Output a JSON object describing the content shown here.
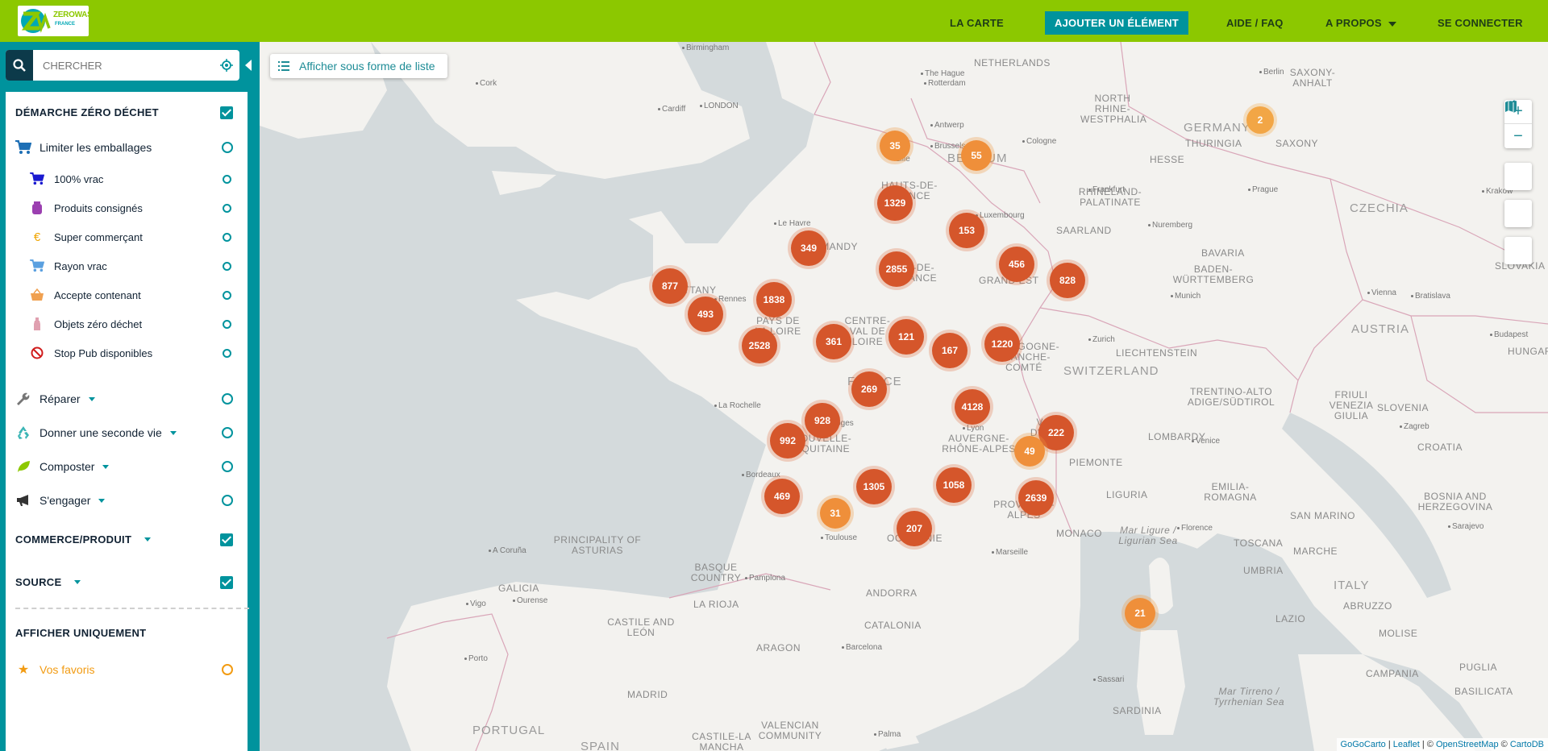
{
  "brand": {
    "logo_text": "ZEROWASTE",
    "logo_sub": "FRANCE"
  },
  "nav": {
    "la_carte": "LA CARTE",
    "ajouter": "AJOUTER UN ÉLÉMENT",
    "aide": "AIDE / FAQ",
    "apropos": "A PROPOS",
    "connecter": "SE CONNECTER"
  },
  "search": {
    "placeholder": "CHERCHER"
  },
  "list_button": "Afficher sous forme de liste",
  "filters": {
    "demarche": "DÉMARCHE ZÉRO DÉCHET",
    "limiter": "Limiter les emballages",
    "sub": [
      "100% vrac",
      "Produits consignés",
      "Super commerçant",
      "Rayon vrac",
      "Accepte contenant",
      "Objets zéro déchet",
      "Stop Pub disponibles"
    ],
    "reparer": "Réparer",
    "donner": "Donner une seconde vie",
    "composter": "Composter",
    "engager": "S'engager",
    "commerce": "COMMERCE/PRODUIT",
    "source": "SOURCE",
    "afficher": "AFFICHER UNIQUEMENT",
    "favoris": "Vos favoris"
  },
  "colors": {
    "brand_green": "#8cc800",
    "teal": "#00939d",
    "cluster": "#d5562b",
    "favoris": "#f29b12"
  },
  "map_labels": {
    "countries": [
      "GERMANY",
      "FRANCE",
      "BELGIUM",
      "CZECHIA",
      "AUSTRIA",
      "SWITZERLAND",
      "ITALY",
      "SPAIN",
      "PORTUGAL",
      "SLOVENIA",
      "CROATIA",
      "LIECHTENSTEIN",
      "SAN MARINO",
      "ANDORRA",
      "MONACO"
    ],
    "regions": [
      "NETHERLANDS",
      "NORTH RHINE-WESTPHALIA",
      "HESSE",
      "THURINGIA",
      "SAXONY",
      "SAXONY-ANHALT",
      "RHINELAND-PALATINATE",
      "SAARLAND",
      "BADEN-WÜRTTEMBERG",
      "BAVARIA",
      "SLOVAKIA",
      "HUNGARY",
      "GRAND EST",
      "BOURGOGNE-FRANCHE-COMTÉ",
      "AUVERGNE-RHÔNE-ALPES",
      "NOUVELLE-AQUITAINE",
      "CENTRE-VAL DE LOIRE",
      "PAYS DE LA LOIRE",
      "BRITTANY",
      "NORMANDY",
      "HAUTS-DE-FRANCE",
      "ÎLE-DE-FRANCE",
      "OCCITANIE",
      "PROVENCE-ALPES",
      "VALLE D'AOSTA",
      "LOMBARDY",
      "PIEMONTE",
      "LIGURIA",
      "EMILIA-ROMAGNA",
      "TOSCANA",
      "UMBRIA",
      "MARCHE",
      "LAZIO",
      "ABRUZZO",
      "MOLISE",
      "CAMPANIA",
      "PUGLIA",
      "BASILICATA",
      "SARDINIA",
      "TRENTINO-ALTO ADIGE/SÜDTIROL",
      "FRIULI VENEZIA GIULIA",
      "BOSNIA AND HERZEGOVINA",
      "PRINCIPALITY OF ASTURIAS",
      "GALICIA",
      "BASQUE COUNTRY",
      "LA RIOJA",
      "CASTILE AND LEÓN",
      "ARAGON",
      "CATALONIA",
      "MADRID",
      "VALENCIAN COMMUNITY",
      "CASTILE-LA MANCHA",
      "Mar Ligure / Ligurian Sea",
      "Mar Tirreno / Tyrrhenian Sea"
    ],
    "cities": [
      "Birmingham",
      "Cork",
      "Cardiff",
      "LONDON",
      "The Hague",
      "Rotterdam",
      "Antwerp",
      "Brussels",
      "Lille",
      "Cologne",
      "Frankfurt",
      "Luxembourg",
      "Nuremberg",
      "Prague",
      "Munich",
      "Vienna",
      "Bratislava",
      "Budapest",
      "Zurich",
      "Krakow",
      "Le Havre",
      "Rennes",
      "Limoges",
      "La Rochelle",
      "Bordeaux",
      "Toulouse",
      "Lyon",
      "Marseille",
      "Venice",
      "Zagreb",
      "Sarajevo",
      "Florence",
      "Barcelona",
      "Pamplona",
      "A Coruña",
      "Ourense",
      "Vigo",
      "Porto",
      "Palma",
      "Sassari",
      "Berlin"
    ]
  },
  "clusters": [
    {
      "v": "35",
      "size": "small"
    },
    {
      "v": "55",
      "size": "small"
    },
    {
      "v": "2",
      "size": "tiny"
    },
    {
      "v": "1329",
      "size": "big"
    },
    {
      "v": "153",
      "size": "big"
    },
    {
      "v": "349",
      "size": "big"
    },
    {
      "v": "2855",
      "size": "big"
    },
    {
      "v": "456",
      "size": "big"
    },
    {
      "v": "828",
      "size": "big"
    },
    {
      "v": "877",
      "size": "big"
    },
    {
      "v": "1838",
      "size": "big"
    },
    {
      "v": "493",
      "size": "big"
    },
    {
      "v": "2528",
      "size": "big"
    },
    {
      "v": "361",
      "size": "big"
    },
    {
      "v": "121",
      "size": "big"
    },
    {
      "v": "167",
      "size": "big"
    },
    {
      "v": "1220",
      "size": "big"
    },
    {
      "v": "269",
      "size": "big"
    },
    {
      "v": "4128",
      "size": "big"
    },
    {
      "v": "928",
      "size": "big"
    },
    {
      "v": "222",
      "size": "big"
    },
    {
      "v": "992",
      "size": "big"
    },
    {
      "v": "49",
      "size": "small"
    },
    {
      "v": "1305",
      "size": "big"
    },
    {
      "v": "1058",
      "size": "big"
    },
    {
      "v": "469",
      "size": "big"
    },
    {
      "v": "2639",
      "size": "big"
    },
    {
      "v": "31",
      "size": "small"
    },
    {
      "v": "207",
      "size": "big"
    },
    {
      "v": "21",
      "size": "small"
    }
  ],
  "attribution": {
    "gogocarto": "GoGoCarto",
    "leaflet": "Leaflet",
    "osm": "OpenStreetMap",
    "carto": "CartoDB"
  }
}
